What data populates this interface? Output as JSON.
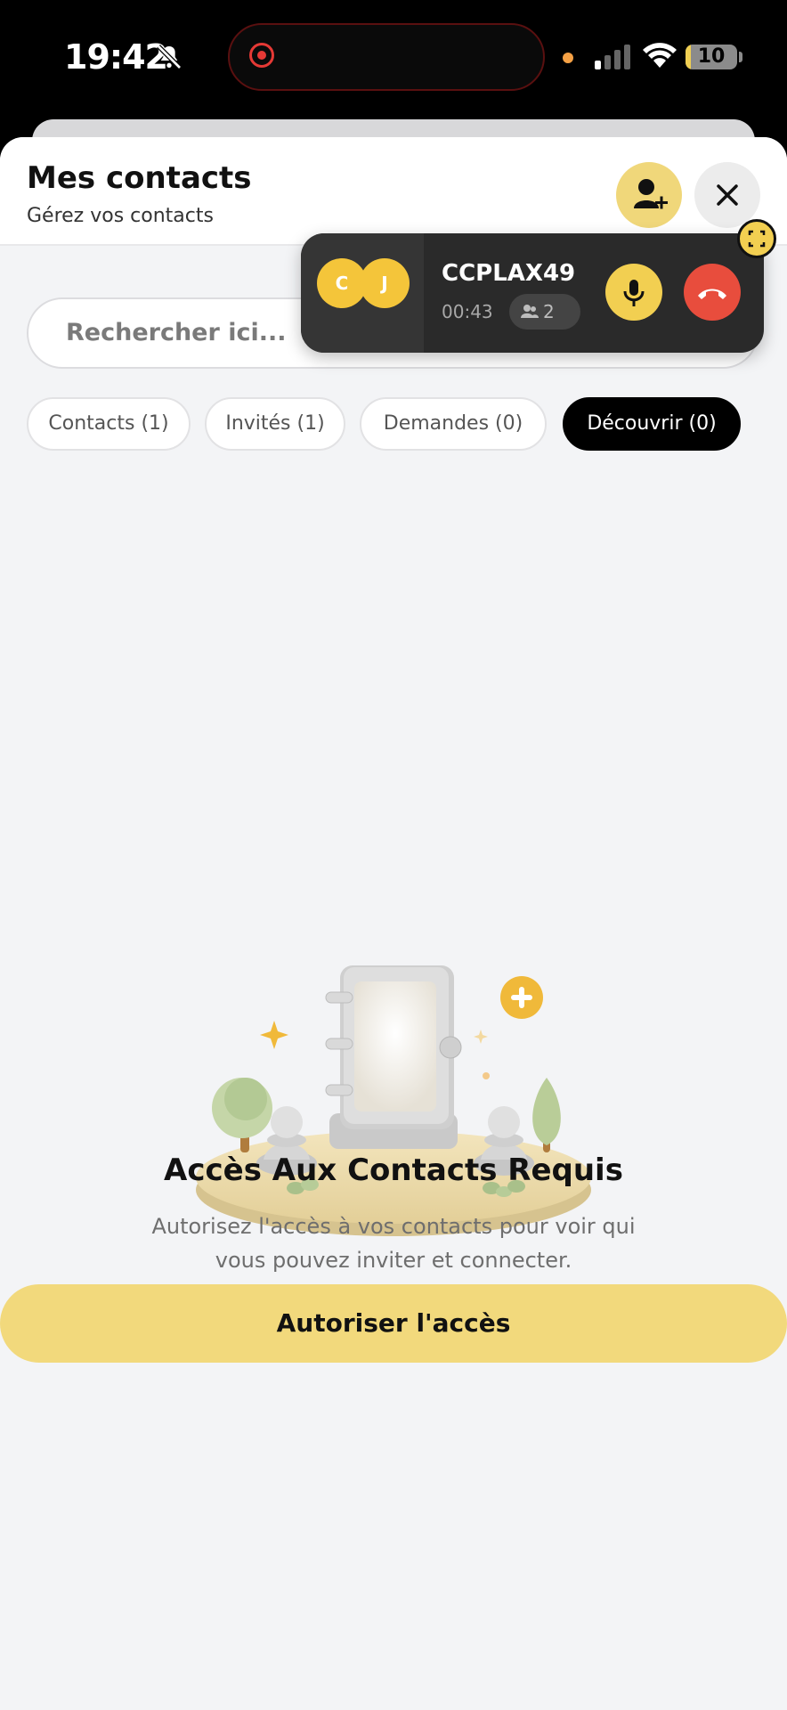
{
  "status_bar": {
    "time": "19:42",
    "battery": "10",
    "battery_level": 0.1,
    "icons": [
      "bell-slash-icon",
      "record-icon",
      "signal-icon",
      "wifi-icon",
      "battery-icon"
    ]
  },
  "header": {
    "title": "Mes contacts",
    "subtitle": "Gérez vos contacts",
    "add_contact_icon": "person-add-icon",
    "close_icon": "close-icon"
  },
  "search": {
    "placeholder": "Rechercher ici..."
  },
  "tabs": [
    {
      "label": "Contacts (1)",
      "active": false
    },
    {
      "label": "Invités (1)",
      "active": false
    },
    {
      "label": "Demandes (0)",
      "active": false
    },
    {
      "label": "Découvrir (0)",
      "active": true
    }
  ],
  "empty_state": {
    "title": "Accès Aux Contacts Requis",
    "description_line1": "Autorisez l'accès à vos contacts pour voir qui",
    "description_line2": "vous pouvez inviter et connecter.",
    "button_label": "Autoriser l'accès"
  },
  "call_widget": {
    "avatars": [
      "C",
      "J"
    ],
    "name": "CCPLAX49",
    "duration": "00:43",
    "participants": "2",
    "colors": {
      "accent": "#f2cf51",
      "hangup": "#e84d3d",
      "background": "#2a2a2a"
    },
    "icons": [
      "mic-icon",
      "phone-hangup-icon",
      "expand-icon",
      "people-icon"
    ]
  },
  "colors": {
    "accent_yellow": "#f2d97c",
    "active_tab": "#000000",
    "page_background": "#f3f4f6"
  }
}
